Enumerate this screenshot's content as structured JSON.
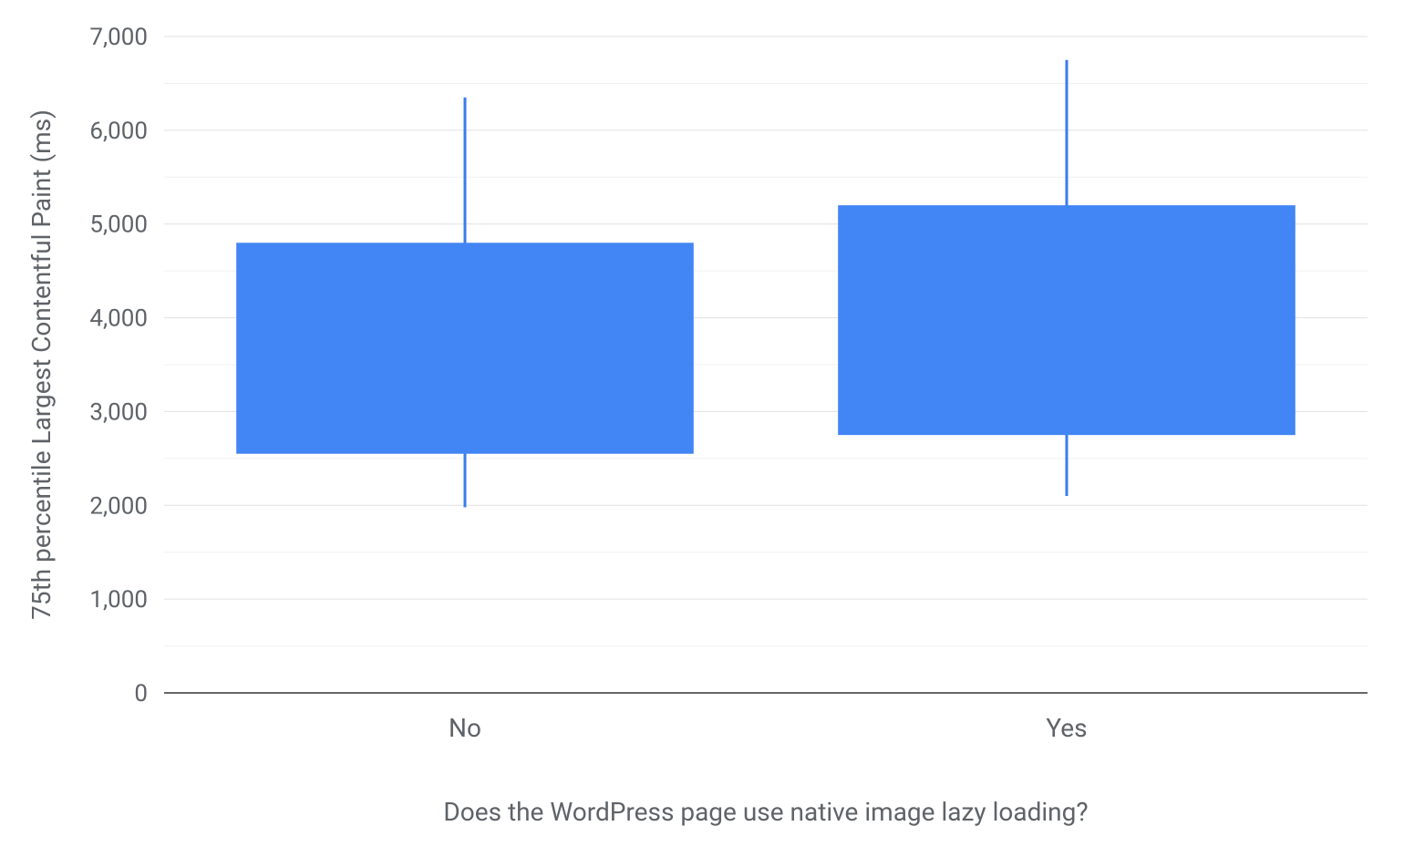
{
  "chart_data": {
    "type": "boxplot",
    "xlabel": "Does the WordPress page use native image lazy loading?",
    "ylabel": "75th percentile Largest Contentful Paint (ms)",
    "ylim": [
      0,
      7000
    ],
    "y_major_ticks": [
      0,
      1000,
      2000,
      3000,
      4000,
      5000,
      6000,
      7000
    ],
    "y_tick_labels": [
      "0",
      "1,000",
      "2,000",
      "3,000",
      "4,000",
      "5,000",
      "6,000",
      "7,000"
    ],
    "categories": [
      "No",
      "Yes"
    ],
    "series": [
      {
        "name": "No",
        "whisker_low": 1980,
        "q1": 2550,
        "q3": 4800,
        "whisker_high": 6350
      },
      {
        "name": "Yes",
        "whisker_low": 2100,
        "q1": 2750,
        "q3": 5200,
        "whisker_high": 6750
      }
    ],
    "box_color": "#4285f4",
    "whisker_color": "#3a7cee"
  }
}
